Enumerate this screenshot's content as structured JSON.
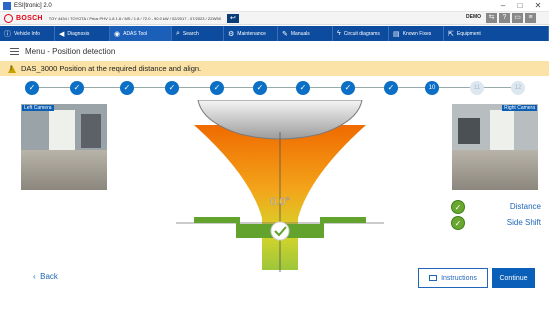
{
  "window": {
    "title": "ESI[tronic] 2.0",
    "min": "–",
    "max": "□",
    "close": "✕"
  },
  "header": {
    "brand": "BOSCH",
    "vehicle": "TOY 4434 / TOYOTA / Prius PHV 1.8 1.8 / MS / 1.8 / 72.0 - 90.0 kW / 02/2017 - 07/2023 / ZZW50",
    "back_glyph": "↩",
    "demo": "DEMO"
  },
  "nav": [
    {
      "label": "Vehicle Info",
      "icon": "info-icon"
    },
    {
      "label": "Diagnosis",
      "icon": "car-icon"
    },
    {
      "label": "ADAS Tool",
      "icon": "adas-icon"
    },
    {
      "label": "Search",
      "icon": "search-icon"
    },
    {
      "label": "Maintenance",
      "icon": "gear-icon"
    },
    {
      "label": "Manuals",
      "icon": "wrench-icon"
    },
    {
      "label": "Circuit diagrams",
      "icon": "lightning-icon"
    },
    {
      "label": "Known Fixes",
      "icon": "book-icon"
    },
    {
      "label": "Equipment",
      "icon": "external-icon"
    }
  ],
  "breadcrumb": {
    "text": "Menu - Position detection"
  },
  "warning": {
    "text": "DAS_3000 Position at the required distance and align."
  },
  "stepper": {
    "current": 10,
    "total": 12,
    "current_label": "10",
    "next1": "11",
    "next2": "12"
  },
  "cameras": {
    "left": "Left Camera",
    "right": "Right Camera"
  },
  "measurement": {
    "value": "0.0°"
  },
  "status": [
    {
      "label": "Distance",
      "ok": true
    },
    {
      "label": "Side Shift",
      "ok": true
    }
  ],
  "footer": {
    "back": "Back",
    "instructions": "Instructions",
    "continue": "Continue"
  },
  "colors": {
    "brand_blue": "#0c4b9e",
    "accent": "#0a6fc5",
    "warning_bg": "#fbe3a8",
    "ok_green": "#6aa72f",
    "bosch_red": "#e20015"
  }
}
